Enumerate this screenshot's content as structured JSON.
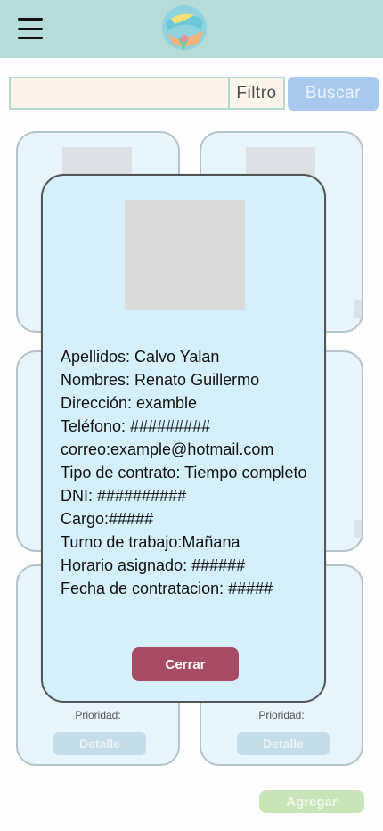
{
  "header": {
    "menu_icon": "hamburger-menu-icon",
    "logo": "app-logo"
  },
  "search": {
    "value": "",
    "placeholder": "",
    "filter_label": "Filtro",
    "button_label": "Buscar"
  },
  "cards": [
    {
      "prioridad_label": "Prioridad:",
      "detail_label": "Detalle"
    },
    {
      "prioridad_label": "Prioridad:",
      "detail_label": "Detalle"
    }
  ],
  "modal": {
    "lines": [
      "Apellidos: Calvo Yalan",
      "Nombres: Renato Guillermo",
      "Dirección: examble",
      "Teléfono: #########",
      "correo:example@hotmail.com",
      "Tipo de contrato: Tiempo completo",
      "DNI: ##########",
      "Cargo:#####",
      "Turno de trabajo:Mañana",
      "Horario asignado: ######",
      "Fecha de contratacion: #####"
    ],
    "close_label": "Cerrar"
  },
  "footer": {
    "add_label": "Agregar"
  },
  "colors": {
    "header": "#b5dcd9",
    "modal_bg": "#d5f0fb",
    "close_button": "#a84c66",
    "add_button": "#c9e5b8",
    "search_button": "#a9c9ee"
  }
}
